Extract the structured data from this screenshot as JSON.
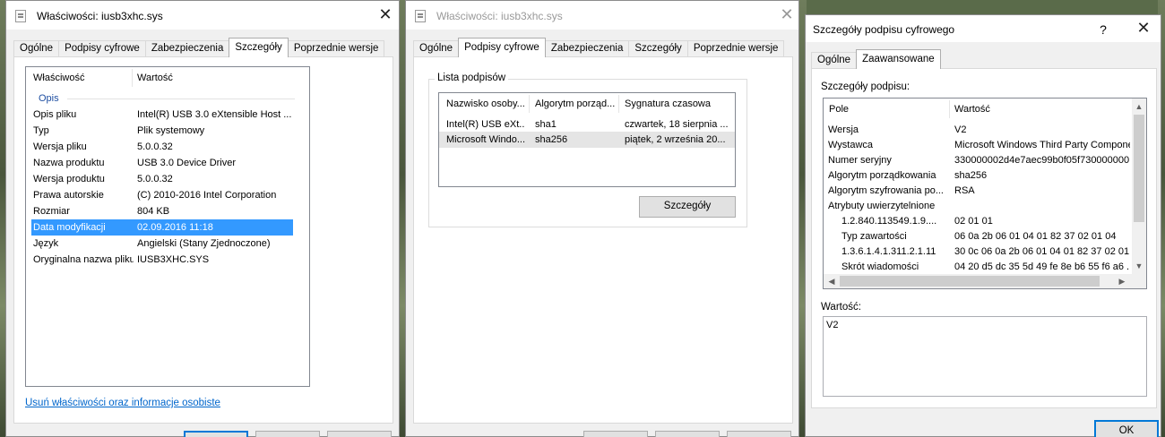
{
  "windows": {
    "properties1": {
      "title": "Właściwości: iusb3xhc.sys",
      "tabs": [
        "Ogólne",
        "Podpisy cyfrowe",
        "Zabezpieczenia",
        "Szczegóły",
        "Poprzednie wersje"
      ],
      "active_tab": "Szczegóły",
      "columns": [
        "Właściwość",
        "Wartość"
      ],
      "section": "Opis",
      "rows": [
        {
          "prop": "Opis pliku",
          "value": "Intel(R) USB 3.0 eXtensible Host ..."
        },
        {
          "prop": "Typ",
          "value": "Plik systemowy"
        },
        {
          "prop": "Wersja pliku",
          "value": "5.0.0.32"
        },
        {
          "prop": "Nazwa produktu",
          "value": "USB 3.0 Device Driver"
        },
        {
          "prop": "Wersja produktu",
          "value": "5.0.0.32"
        },
        {
          "prop": "Prawa autorskie",
          "value": "(C) 2010-2016 Intel Corporation"
        },
        {
          "prop": "Rozmiar",
          "value": "804 KB"
        },
        {
          "prop": "Data modyfikacji",
          "value": "02.09.2016 11:18",
          "selected": true
        },
        {
          "prop": "Język",
          "value": "Angielski (Stany Zjednoczone)"
        },
        {
          "prop": "Oryginalna nazwa pliku",
          "value": "IUSB3XHC.SYS"
        }
      ],
      "link": "Usuń właściwości oraz informacje osobiste"
    },
    "properties2": {
      "title": "Właściwości: iusb3xhc.sys",
      "tabs": [
        "Ogólne",
        "Podpisy cyfrowe",
        "Zabezpieczenia",
        "Szczegóły",
        "Poprzednie wersje"
      ],
      "active_tab": "Podpisy cyfrowe",
      "group_label": "Lista podpisów",
      "columns": [
        "Nazwisko osoby...",
        "Algorytm porząd...",
        "Sygnatura czasowa"
      ],
      "rows": [
        {
          "name": "Intel(R) USB eXt...",
          "algorithm": "sha1",
          "timestamp": "czwartek, 18 sierpnia ..."
        },
        {
          "name": "Microsoft Windo...",
          "algorithm": "sha256",
          "timestamp": "piątek, 2 września 20...",
          "highlighted": true
        }
      ],
      "details_button": "Szczegóły"
    },
    "signature_details": {
      "title": "Szczegóły podpisu cyfrowego",
      "help": "?",
      "tabs": [
        "Ogólne",
        "Zaawansowane"
      ],
      "active_tab": "Zaawansowane",
      "details_label": "Szczegóły podpisu:",
      "columns": [
        "Pole",
        "Wartość"
      ],
      "rows": [
        {
          "field": "Wersja",
          "value": "V2",
          "indent": 0
        },
        {
          "field": "Wystawca",
          "value": "Microsoft Windows Third Party Compone...",
          "indent": 0
        },
        {
          "field": "Numer seryjny",
          "value": "330000002d4e7aec99b0f05f730000000...",
          "indent": 0
        },
        {
          "field": "Algorytm porządkowania",
          "value": "sha256",
          "indent": 0
        },
        {
          "field": "Algorytm szyfrowania po...",
          "value": "RSA",
          "indent": 0
        },
        {
          "field": "Atrybuty uwierzytelnione",
          "value": "",
          "indent": 0
        },
        {
          "field": "1.2.840.113549.1.9....",
          "value": "02 01 01",
          "indent": 1
        },
        {
          "field": "Typ zawartości",
          "value": "06 0a 2b 06 01 04 01 82 37 02 01 04",
          "indent": 1
        },
        {
          "field": "1.3.6.1.4.1.311.2.1.11",
          "value": "30 0c 06 0a 2b 06 01 04 01 82 37 02 01 1",
          "indent": 1
        },
        {
          "field": "Skrót wiadomości",
          "value": "04 20 d5 dc 35 5d 49 fe 8e b6 55 f6 a6 ...",
          "indent": 1
        }
      ],
      "value_label": "Wartość:",
      "value_text": "V2",
      "ok_button": "OK"
    }
  },
  "colors": {
    "selection": "#3399ff",
    "link": "#0066cc",
    "accent_border": "#0078d7"
  }
}
